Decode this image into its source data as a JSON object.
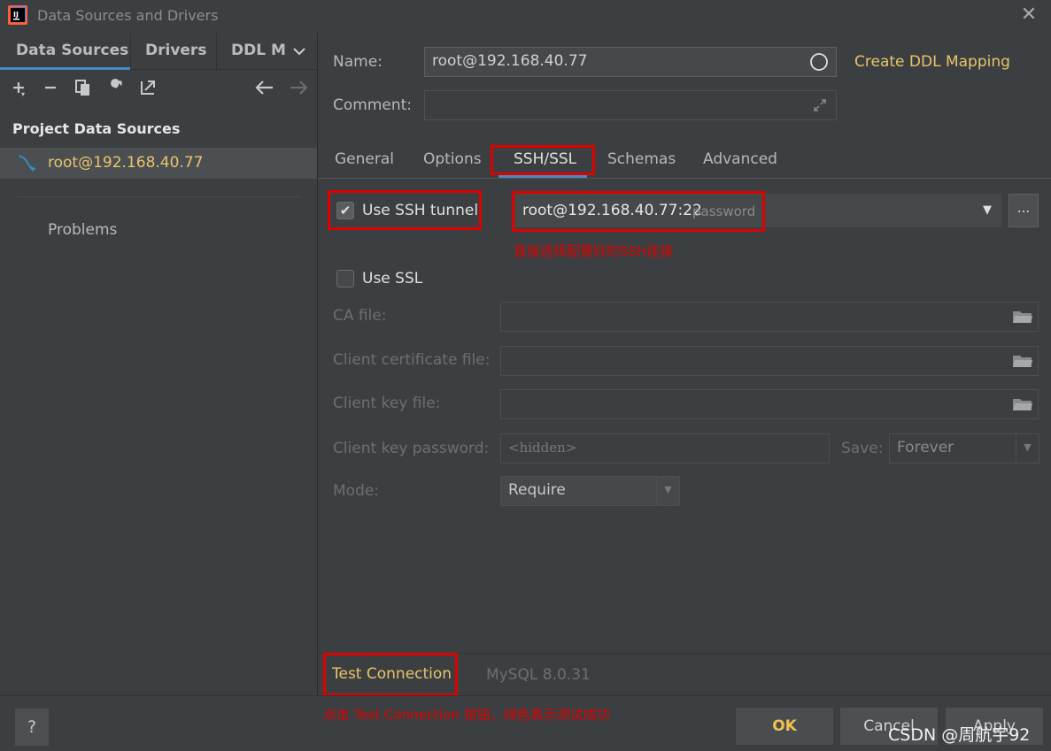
{
  "window": {
    "title": "Data Sources and Drivers"
  },
  "left": {
    "tabs": [
      "Data Sources",
      "Drivers",
      "DDL M"
    ],
    "section_title": "Project Data Sources",
    "datasource": "root@192.168.40.77",
    "problems": "Problems"
  },
  "form": {
    "name_label": "Name:",
    "name_value": "root@192.168.40.77",
    "create_ddl": "Create DDL Mapping",
    "comment_label": "Comment:",
    "comment_value": ""
  },
  "tabs": [
    "General",
    "Options",
    "SSH/SSL",
    "Schemas",
    "Advanced"
  ],
  "active_tab": "SSH/SSL",
  "ssh": {
    "use_ssh_label": "Use SSH tunnel",
    "use_ssh_checked": true,
    "config_value": "root@192.168.40.77:22",
    "config_auth": "password",
    "more_label": "...",
    "annotation": "直接选择配置好的SSH连接"
  },
  "ssl": {
    "use_ssl_label": "Use SSL",
    "use_ssl_checked": false,
    "ca_label": "CA file:",
    "client_cert_label": "Client certificate file:",
    "client_key_label": "Client key file:",
    "key_password_label": "Client key password:",
    "key_password_placeholder": "<hidden>",
    "save_label": "Save:",
    "save_value": "Forever",
    "mode_label": "Mode:",
    "mode_value": "Require"
  },
  "bottom": {
    "test_connection": "Test Connection",
    "driver_version": "MySQL 8.0.31",
    "annotation": "点击 Test Connection 按钮，绿色表示测试成功"
  },
  "footer": {
    "help": "?",
    "ok": "OK",
    "cancel": "Cancel",
    "apply": "Apply",
    "watermark": "CSDN @周航宇92"
  },
  "colors": {
    "accent": "#e8c46b",
    "highlight_box": "#e00000",
    "tab_underline": "#4a88c7"
  }
}
